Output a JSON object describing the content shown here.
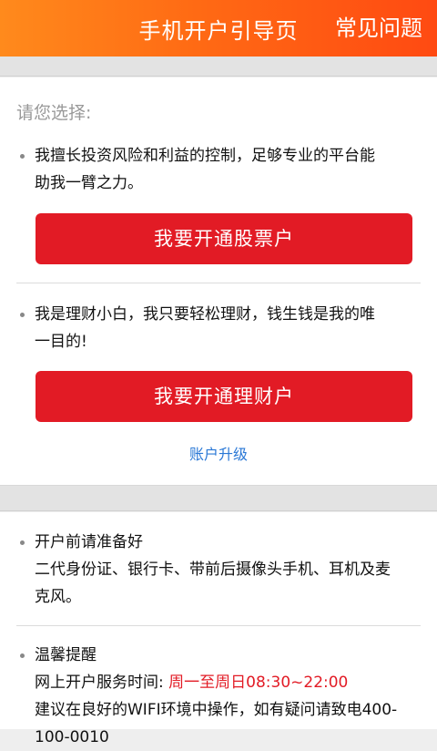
{
  "header": {
    "title": "手机开户引导页",
    "faq_label": "常见问题"
  },
  "choice": {
    "prompt": "请您选择:",
    "option1": {
      "line1": "我擅长投资风险和利益的控制，足够专业的平台能",
      "line2": "助我一臂之力。",
      "button": "我要开通股票户"
    },
    "option2": {
      "line1": "我是理财小白，我只要轻松理财，钱生钱是我的唯",
      "line2": "一目的!",
      "button": "我要开通理财户"
    },
    "upgrade_link": "账户升级"
  },
  "prepare": {
    "title": "开户前请准备好",
    "line1": "二代身份证、银行卡、带前后摄像头手机、耳机及麦",
    "line2": "克风。"
  },
  "tips": {
    "title": "温馨提醒",
    "service_label": "网上开户服务时间:",
    "service_days": "周一至周日",
    "service_hours": "08:30~22:00",
    "advice": "建议在良好的WIFI环境中操作，如有疑问请致电400-",
    "phone_tail": "100-0010"
  },
  "colors": {
    "header_start": "#ff8a1c",
    "header_end": "#ff4a12",
    "button_red": "#e21b25",
    "link_blue": "#2a78d6"
  }
}
